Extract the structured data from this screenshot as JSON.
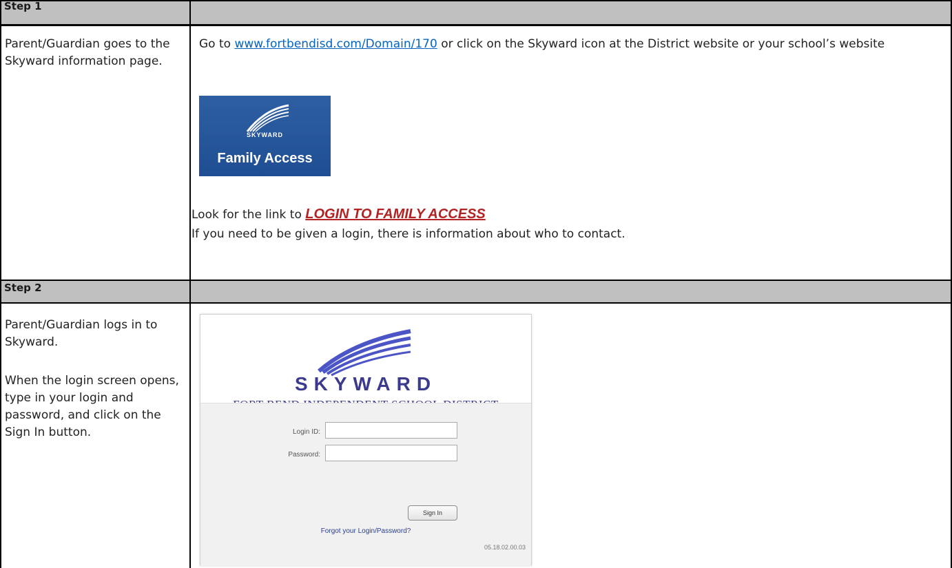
{
  "step1": {
    "label": "Step 1",
    "left_text": "Parent/Guardian goes to the Skyward information page.",
    "go_to": "Go to",
    "url": "www.fortbendisd.com/Domain/170",
    "after_url": "or click on the Skyward icon at the District website or your school’s website",
    "tile": {
      "brand": "SKYWARD",
      "title": "Family Access"
    },
    "look_for": "Look for the link to",
    "login_link": "LOGIN TO FAMILY ACCESS",
    "info": "If you need to be given a login, there is information about who to contact."
  },
  "step2": {
    "label": "Step 2",
    "left_line1": "Parent/Guardian logs in to Skyward.",
    "left_line2": "When the login screen opens, type in your login and password, and click on the Sign In button.",
    "login": {
      "brand": "SKYWARD",
      "district": "FORT BEND INDEPENDENT SCHOOL DISTRICT",
      "login_id_label": "Login ID:",
      "password_label": "Password:",
      "signin_label": "Sign In",
      "forgot": "Forgot your Login/Password?",
      "version": "05.18.02.00.03"
    }
  },
  "colors": {
    "header_bg": "#c0c0c0",
    "link": "#0563c1",
    "fa_link": "#b22222",
    "skyward_blue": "#3b3a8c"
  }
}
